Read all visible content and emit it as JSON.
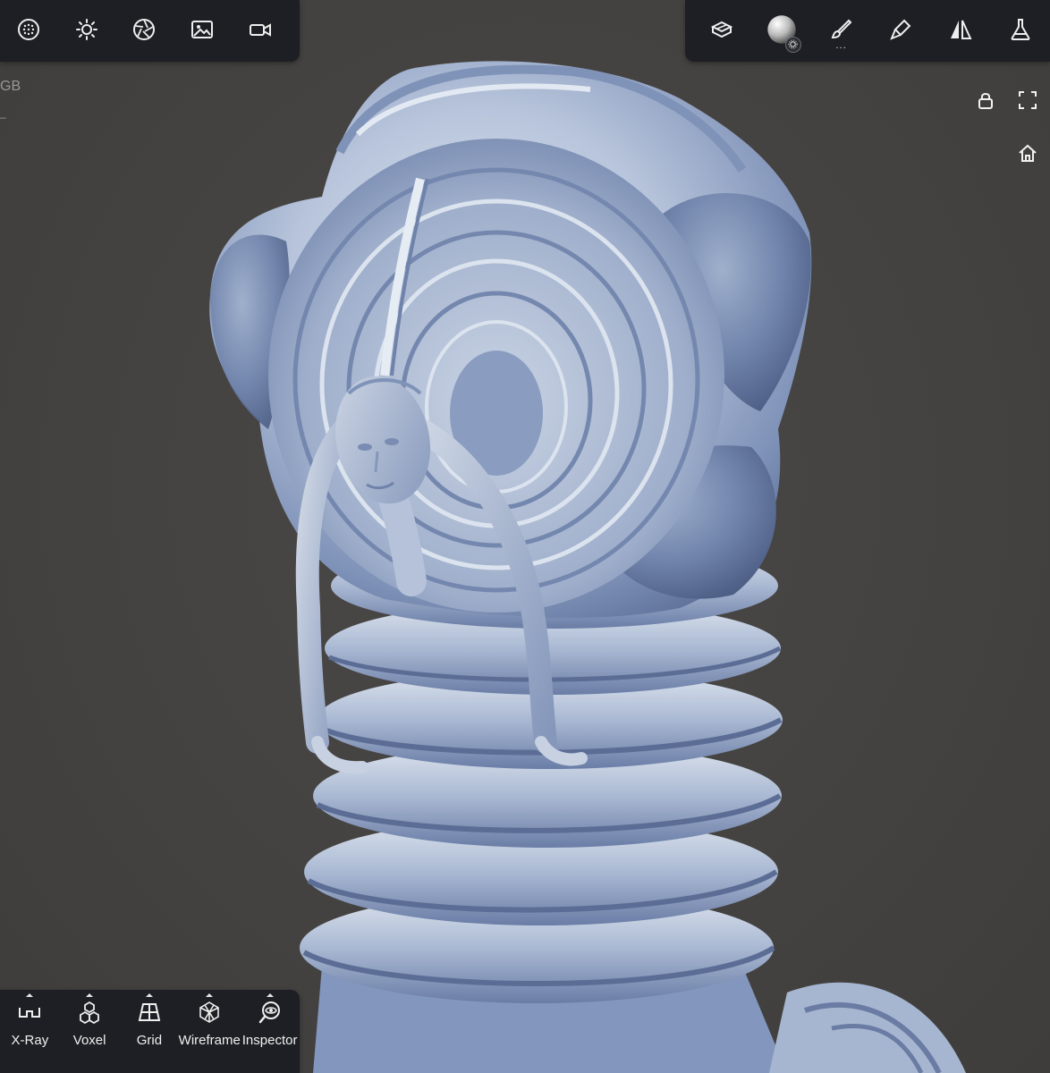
{
  "app": {
    "accent": "#ffffff",
    "panel_color": "#1e1f24",
    "background_color": "#454342"
  },
  "top_left_toolbar": {
    "items": [
      {
        "icon": "matcap-sphere-icon"
      },
      {
        "icon": "light-icon"
      },
      {
        "icon": "camera-aperture-icon"
      },
      {
        "icon": "background-image-icon"
      },
      {
        "icon": "video-camera-icon"
      }
    ]
  },
  "top_right_toolbar": {
    "items": [
      {
        "icon": "scene-layers-icon"
      },
      {
        "icon": "material-sphere-icon"
      },
      {
        "icon": "brush-icon",
        "more_indicator": "..."
      },
      {
        "icon": "paint-tool-icon"
      },
      {
        "icon": "symmetry-icon"
      },
      {
        "icon": "flask-icon"
      }
    ]
  },
  "viewport": {
    "info_label": "GB",
    "info_sub": "–"
  },
  "side_controls": [
    {
      "icon": "lock-icon"
    },
    {
      "icon": "fullscreen-icon"
    },
    {
      "icon": "home-icon"
    }
  ],
  "bottom_toolbar": {
    "items": [
      {
        "label": "X-Ray",
        "icon": "xray-glasses-icon"
      },
      {
        "label": "Voxel",
        "icon": "voxel-cubes-icon"
      },
      {
        "label": "Grid",
        "icon": "grid-plane-icon"
      },
      {
        "label": "Wireframe",
        "icon": "wireframe-icon"
      },
      {
        "label": "Inspector",
        "icon": "inspector-eye-icon"
      }
    ]
  }
}
